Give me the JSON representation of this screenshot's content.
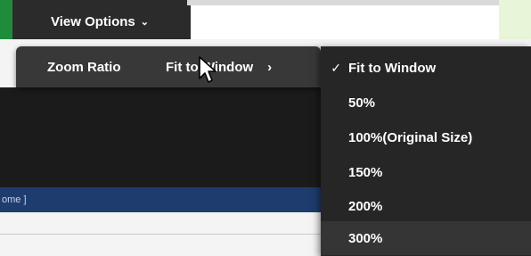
{
  "header": {
    "view_options_label": "View Options",
    "chevron": "⌄"
  },
  "menu": {
    "zoom_ratio_label": "Zoom Ratio",
    "fit_label": "Fit to Window",
    "arrow": "›"
  },
  "submenu": {
    "options": [
      {
        "label": "Fit to Window",
        "checked": true,
        "check": "✓"
      },
      {
        "label": "50%",
        "checked": false,
        "check": ""
      },
      {
        "label": "100%(Original Size)",
        "checked": false,
        "check": ""
      },
      {
        "label": "150%",
        "checked": false,
        "check": ""
      },
      {
        "label": "200%",
        "checked": false,
        "check": ""
      },
      {
        "label": "300%",
        "checked": false,
        "check": ""
      }
    ]
  },
  "status": {
    "text": "ome ]"
  },
  "colors": {
    "accent_green": "#1e8c3a",
    "menu_bg": "#383838",
    "submenu_bg": "#262626",
    "status_blue": "#1e3c6e"
  },
  "icons": {
    "cursor": "mouse-pointer-icon",
    "checkmark": "checkmark-icon",
    "submenu_arrow": "chevron-right-icon",
    "dropdown": "chevron-down-icon"
  }
}
